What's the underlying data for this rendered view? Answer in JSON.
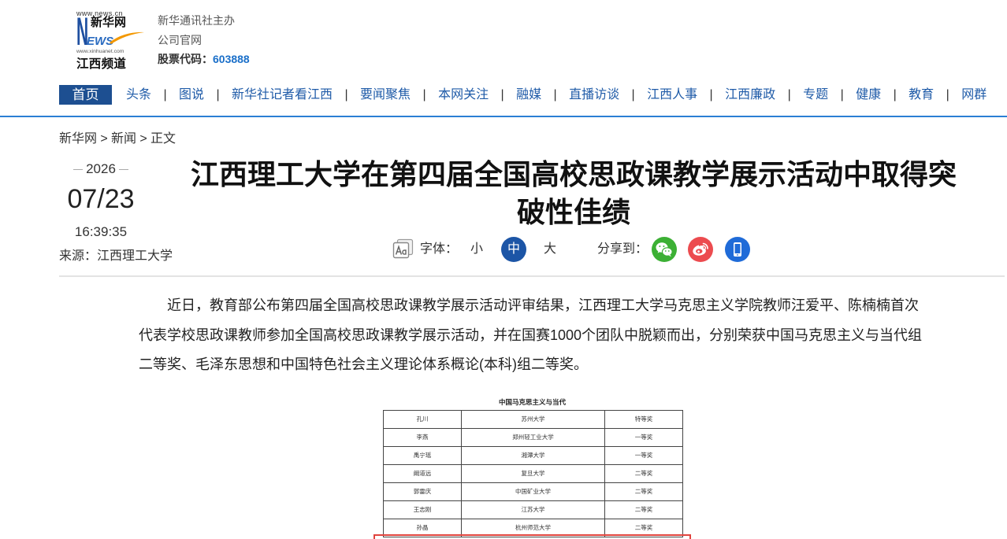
{
  "logo": {
    "url_top": "www.news.cn",
    "letter_n": "N",
    "brand_cn": "新华网",
    "letters_ews": "EWS",
    "url_bottom": "www.xinhuanet.com",
    "channel": "江西频道"
  },
  "header_info": {
    "sponsor": "新华通讯社主办",
    "company_site": "公司官网",
    "stock_label": "股票代码：",
    "stock_code": "603888"
  },
  "nav": {
    "separator": "|",
    "items": [
      {
        "label": "首页",
        "active": true
      },
      {
        "label": "头条"
      },
      {
        "label": "图说"
      },
      {
        "label": "新华社记者看江西"
      },
      {
        "label": "要闻聚焦"
      },
      {
        "label": "本网关注"
      },
      {
        "label": "融媒"
      },
      {
        "label": "直播访谈"
      },
      {
        "label": "江西人事"
      },
      {
        "label": "江西廉政"
      },
      {
        "label": "专题"
      },
      {
        "label": "健康"
      },
      {
        "label": "教育"
      },
      {
        "label": "网群"
      }
    ]
  },
  "breadcrumb": {
    "separator": ">",
    "items": [
      "新华网",
      "新闻",
      "正文"
    ]
  },
  "article": {
    "year": "2026",
    "date": "07/23",
    "time": "16:39:35",
    "source_label": "来源：",
    "source": "江西理工大学",
    "title": "江西理工大学在第四届全国高校思政课教学展示活动中取得突破性佳绩",
    "paragraph": "近日，教育部公布第四届全国高校思政课教学展示活动评审结果，江西理工大学马克思主义学院教师汪爱平、陈楠楠首次代表学校思政课教师参加全国高校思政课教学展示活动，并在国赛1000个团队中脱颖而出，分别荣获中国马克思主义与当代组二等奖、毛泽东思想和中国特色社会主义理论体系概论(本科)组二等奖。"
  },
  "toolbar": {
    "font_icon": "font-size-icon",
    "font_label": "字体：",
    "font_sizes": [
      "小",
      "中",
      "大"
    ],
    "font_active_index": 1,
    "share_label": "分享到：",
    "share_icons": [
      "wechat-icon",
      "weibo-icon",
      "mobile-icon"
    ]
  },
  "figure": {
    "caption": "中国马克思主义与当代",
    "rows": [
      [
        "孔川",
        "苏州大学",
        "特等奖"
      ],
      [
        "李燕",
        "郑州轻工业大学",
        "一等奖"
      ],
      [
        "禹宁瑶",
        "湘潭大学",
        "一等奖"
      ],
      [
        "阚道远",
        "复旦大学",
        "二等奖"
      ],
      [
        "郭雷庆",
        "中国矿业大学",
        "二等奖"
      ],
      [
        "王志刚",
        "江苏大学",
        "二等奖"
      ],
      [
        "孙晶",
        "杭州师范大学",
        "二等奖"
      ]
    ]
  },
  "colors": {
    "logo_blue": "#1e4fa0",
    "logo_light_blue": "#2a6bc0",
    "logo_orange": "#f39800",
    "link_blue": "#1a6fc9",
    "nav_text": "#1f5ba8",
    "nav_active_bg": "#1d4f91",
    "divider_blue": "#2a7fd4",
    "font_active_bg": "#1c55a6",
    "wechat": "#3cb034",
    "weibo": "#ec4b4f",
    "mobile": "#1f6bd8",
    "highlight_red": "#e0443e"
  }
}
